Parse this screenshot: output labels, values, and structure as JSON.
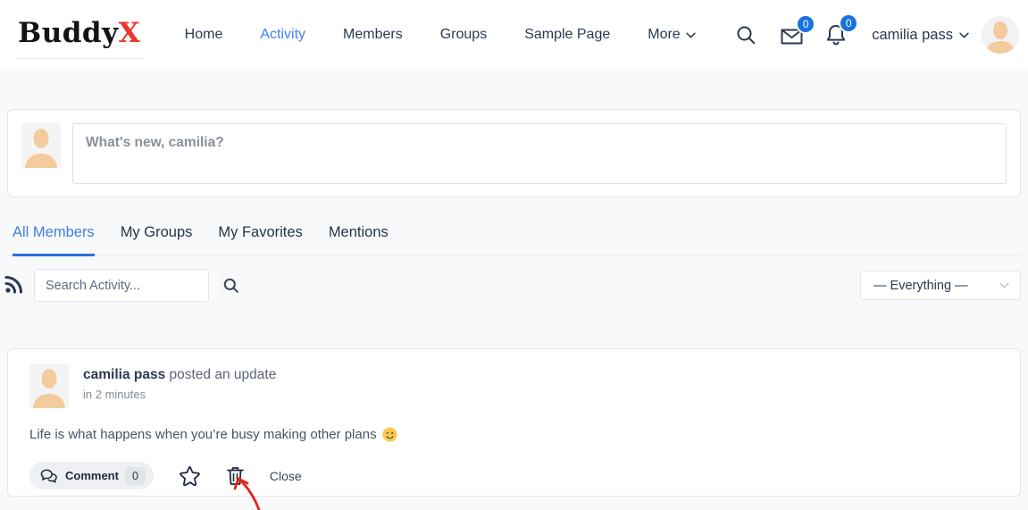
{
  "header": {
    "logo": {
      "text_primary": "Buddy",
      "text_accent": "X"
    },
    "nav": [
      {
        "label": "Home",
        "active": false
      },
      {
        "label": "Activity",
        "active": true
      },
      {
        "label": "Members",
        "active": false
      },
      {
        "label": "Groups",
        "active": false
      },
      {
        "label": "Sample Page",
        "active": false
      },
      {
        "label": "More",
        "active": false,
        "has_dropdown": true
      }
    ],
    "messages_badge": "0",
    "notifications_badge": "0",
    "user_name": "camilia pass"
  },
  "composer": {
    "placeholder": "What's new, camilia?"
  },
  "tabs": [
    {
      "label": "All Members",
      "active": true
    },
    {
      "label": "My Groups",
      "active": false
    },
    {
      "label": "My Favorites",
      "active": false
    },
    {
      "label": "Mentions",
      "active": false
    }
  ],
  "filter": {
    "search_placeholder": "Search Activity...",
    "dropdown_value": "— Everything —"
  },
  "post": {
    "author": "camilia pass",
    "action_text": " posted an update",
    "timestamp": "in 2 minutes",
    "content": "Life is what happens when you’re busy making other plans",
    "emoji": "slightly-smiling-face",
    "comment_label": "Comment",
    "comment_count": "0",
    "close_label": "Close"
  },
  "colors": {
    "accent_blue": "#3e82e7",
    "badge_blue": "#1673de",
    "logo_red": "#e8392f",
    "annotation_red": "#e3251b",
    "card_border": "#e4e6ea",
    "page_bg": "#f8f9fb"
  }
}
